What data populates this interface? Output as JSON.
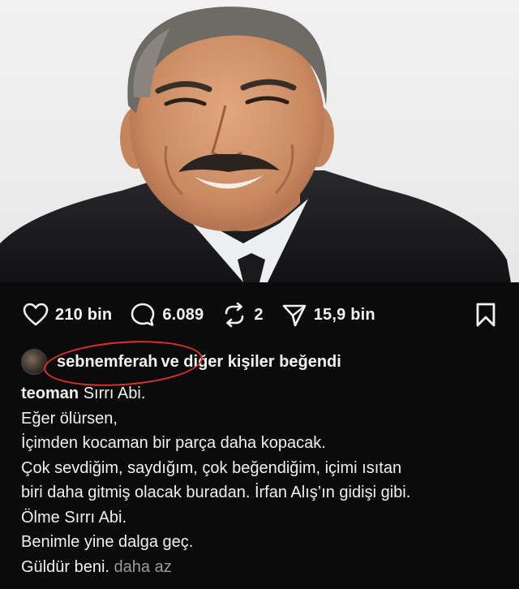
{
  "post": {
    "photo": {
      "subject": "portrait-photo"
    },
    "actions": {
      "likes": "210 bin",
      "comments": "6.089",
      "reposts": "2",
      "shares": "15,9 bin"
    },
    "liked_by": {
      "user": "sebnemferah",
      "suffix": "ve diğer kişiler beğendi"
    },
    "caption": {
      "author": "teoman",
      "first_line_text": "Sırrı Abi.",
      "lines": [
        "Eğer ölürsen,",
        "İçimden kocaman bir parça daha kopacak.",
        "Çok sevdiğim, saydığım, çok beğendiğim, içimi ısıtan",
        "biri daha gitmiş olacak buradan. İrfan Alış’ın gidişi gibi.",
        "Ölme Sırrı Abi.",
        "Benimle yine dalga geç."
      ],
      "last_line": "Güldür beni.",
      "less_label": "daha az"
    },
    "colors": {
      "background": "#0b0b0c",
      "annotation_circle": "#e0312b",
      "muted": "#9a9a9a"
    }
  }
}
